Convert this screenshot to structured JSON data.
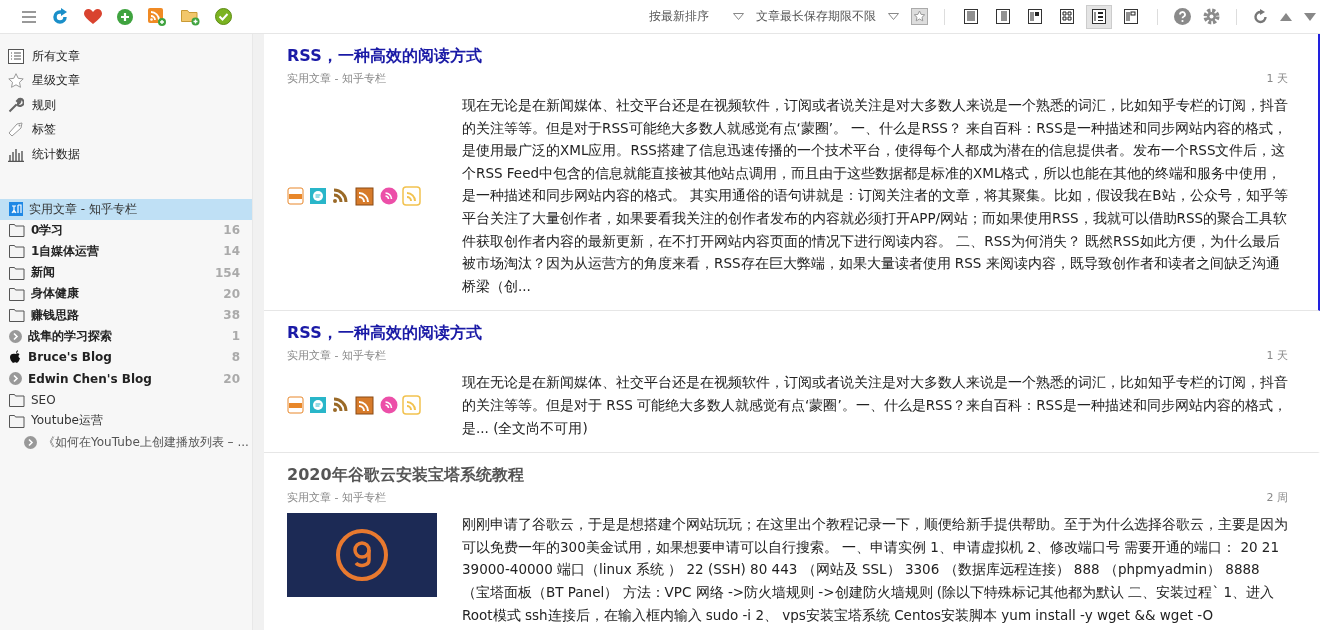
{
  "toolbar": {
    "sort": "按最新排序",
    "retention": "文章最长保存期限不限",
    "views": [
      {
        "selected": false
      },
      {
        "selected": false
      },
      {
        "selected": false
      },
      {
        "selected": false
      },
      {
        "selected": true
      },
      {
        "selected": false
      }
    ]
  },
  "sidebar": {
    "special": [
      {
        "kind": "all",
        "label": "所有文章"
      },
      {
        "kind": "starred",
        "label": "星级文章"
      },
      {
        "kind": "rules",
        "label": "规则"
      },
      {
        "kind": "tags",
        "label": "标签"
      },
      {
        "kind": "stats",
        "label": "统计数据"
      }
    ],
    "feeds": [
      {
        "kind": "zhihu",
        "label": "实用文章 - 知乎专栏",
        "selected": true,
        "bold": false
      },
      {
        "kind": "folder",
        "label": "0学习",
        "count": "16",
        "selected": false,
        "bold": true
      },
      {
        "kind": "folder",
        "label": "1自媒体运营",
        "count": "14",
        "selected": false,
        "bold": true
      },
      {
        "kind": "folder",
        "label": "新闻",
        "count": "154",
        "selected": false,
        "bold": true
      },
      {
        "kind": "folder",
        "label": "身体健康",
        "count": "20",
        "selected": false,
        "bold": true
      },
      {
        "kind": "folder",
        "label": "赚钱思路",
        "count": "38",
        "selected": false,
        "bold": true
      },
      {
        "kind": "feed",
        "label": "战隼的学习探索",
        "count": "1",
        "selected": false,
        "bold": true
      },
      {
        "kind": "apple",
        "label": "Bruce's Blog",
        "count": "8",
        "selected": false,
        "bold": true
      },
      {
        "kind": "feed",
        "label": "Edwin Chen's Blog",
        "count": "20",
        "selected": false,
        "bold": true
      },
      {
        "kind": "folder",
        "label": "SEO",
        "selected": false,
        "bold": false
      },
      {
        "kind": "folder",
        "label": "Youtube运营",
        "selected": false,
        "bold": false,
        "children": [
          {
            "kind": "feed",
            "label": "《如何在YouTube上创建播放列表 – ...",
            "selected": false,
            "bold": false
          }
        ]
      }
    ]
  },
  "articles": [
    {
      "title": "RSS，一种高效的阅读方式",
      "unread": true,
      "selected": true,
      "feed": "实用文章 - 知乎专栏",
      "time": "1 天",
      "kind": "rss-icons",
      "body": "现在无论是在新闻媒体、社交平台还是在视频软件，订阅或者说关注是对大多数人来说是一个熟悉的词汇，比如知乎专栏的订阅，抖音的关注等等。但是对于RSS可能绝大多数人就感觉有点‘蒙圈’。 一、什么是RSS？ 来自百科：RSS是一种描述和同步网站内容的格式，是使用最广泛的XML应用。RSS搭建了信息迅速传播的一个技术平台，使得每个人都成为潜在的信息提供者。发布一个RSS文件后，这个RSS Feed中包含的信息就能直接被其他站点调用，而且由于这些数据都是标准的XML格式，所以也能在其他的终端和服务中使用，是一种描述和同步网站内容的格式。 其实用通俗的语句讲就是：订阅关注者的文章，将其聚集。比如，假设我在B站，公众号，知乎等平台关注了大量创作者，如果要看我关注的创作者发布的内容就必须打开APP/网站；而如果使用RSS，我就可以借助RSS的聚合工具软件获取创作者内容的最新更新，在不打开网站内容页面的情况下进行阅读内容。 二、RSS为何消失？ 既然RSS如此方便，为什么最后被市场淘汰？因为从运营方的角度来看，RSS存在巨大弊端，如果大量读者使用 RSS 来阅读内容，既导致创作者和读者之间缺乏沟通桥梁（创..."
    },
    {
      "title": "RSS，一种高效的阅读方式",
      "unread": true,
      "selected": false,
      "feed": "实用文章 - 知乎专栏",
      "time": "1 天",
      "kind": "rss-icons",
      "body": "现在无论是在新闻媒体、社交平台还是在视频软件，订阅或者说关注是对大多数人来说是一个熟悉的词汇，比如知乎专栏的订阅，抖音的关注等等。但是对于 RSS 可能绝大多数人就感觉有点‘蒙圈’。一、什么是RSS？来自百科：RSS是一种描述和同步网站内容的格式，是... (全文尚不可用)"
    },
    {
      "title": "2020年谷歌云安装宝塔系统教程",
      "unread": false,
      "selected": false,
      "feed": "实用文章 - 知乎专栏",
      "time": "2 周",
      "kind": "image",
      "body": "刚刚申请了谷歌云，于是是想搭建个网站玩玩；在这里出个教程记录一下，顺便给新手提供帮助。至于为什么选择谷歌云，主要是因为可以免费一年的300美金试用，如果想要申请可以自行搜索。 一、申请实例 1、申请虚拟机 2、修改端口号 需要开通的端口： 20 21 39000-40000 端口（linux 系统 ） 22 (SSH) 80 443 （网站及 SSL） 3306 （数据库远程连接） 888 （phpmyadmin） 8888 （宝塔面板（BT Panel） 方法：VPC 网络 ->防火墙规则 ->创建防火墙规则 (除以下特殊标记其他都为默认 二、安装过程` 1、进入Root模式 ssh连接后，在输入框内输入 sudo -i 2、 vps安装宝塔系统 Centos安装脚本 yum install -y wget && wget -O"
    }
  ]
}
